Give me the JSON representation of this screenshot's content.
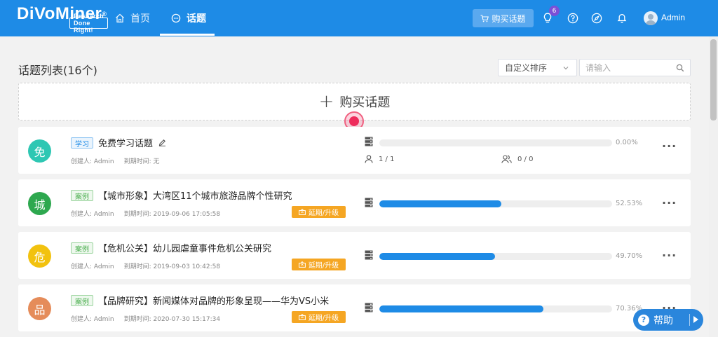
{
  "header": {
    "logo": {
      "brand": "DiVoMiner",
      "reg": "®",
      "tagline": "Research Done Right!"
    },
    "nav": {
      "home": "首页",
      "topics": "话题"
    },
    "buy_button": "购买话题",
    "notification_count": "6",
    "user_name": "Admin"
  },
  "toolbar": {
    "list_title": "话题列表(16个)",
    "sort_selected": "自定义排序",
    "search_placeholder": "请输入"
  },
  "buy_card": {
    "label": "购买话题"
  },
  "rows": [
    {
      "avatar_char": "免",
      "avatar_color": "#2ec7b3",
      "tag": "学习",
      "title": "免费学习话题",
      "creator_label": "创建人:",
      "creator": "Admin",
      "expire_label": "到期时间:",
      "expire": "无",
      "users": "1 / 1",
      "coders": "0 / 0",
      "progress": 0.0,
      "progress_text": "0.00%"
    },
    {
      "avatar_char": "城",
      "avatar_color": "#2ea84f",
      "tag": "案例",
      "title": "【城市形象】大湾区11个城市旅游品牌个性研究",
      "creator_label": "创建人:",
      "creator": "Admin",
      "expire_label": "到期时间:",
      "expire": "2019-09-06 17:05:58",
      "extend": "延期/升级",
      "progress": 0.5253,
      "progress_text": "52.53%"
    },
    {
      "avatar_char": "危",
      "avatar_color": "#f2c20f",
      "tag": "案例",
      "title": "【危机公关】幼儿园虐童事件危机公关研究",
      "creator_label": "创建人:",
      "creator": "Admin",
      "expire_label": "到期时间:",
      "expire": "2019-09-03 10:42:58",
      "extend": "延期/升级",
      "progress": 0.497,
      "progress_text": "49.70%"
    },
    {
      "avatar_char": "品",
      "avatar_color": "#e58c5a",
      "tag": "案例",
      "title": "【品牌研究】新闻媒体对品牌的形象呈现——华为VS小米",
      "creator_label": "创建人:",
      "creator": "Admin",
      "expire_label": "到期时间:",
      "expire": "2020-07-30 15:17:34",
      "extend": "延期/升级",
      "progress": 0.7036,
      "progress_text": "70.36%"
    }
  ],
  "help": {
    "label": "帮助"
  },
  "colors": {
    "header": "#1e8be6",
    "accent": "#1e8be6",
    "extend": "#f5a623",
    "badge": "#7b4fd6"
  }
}
